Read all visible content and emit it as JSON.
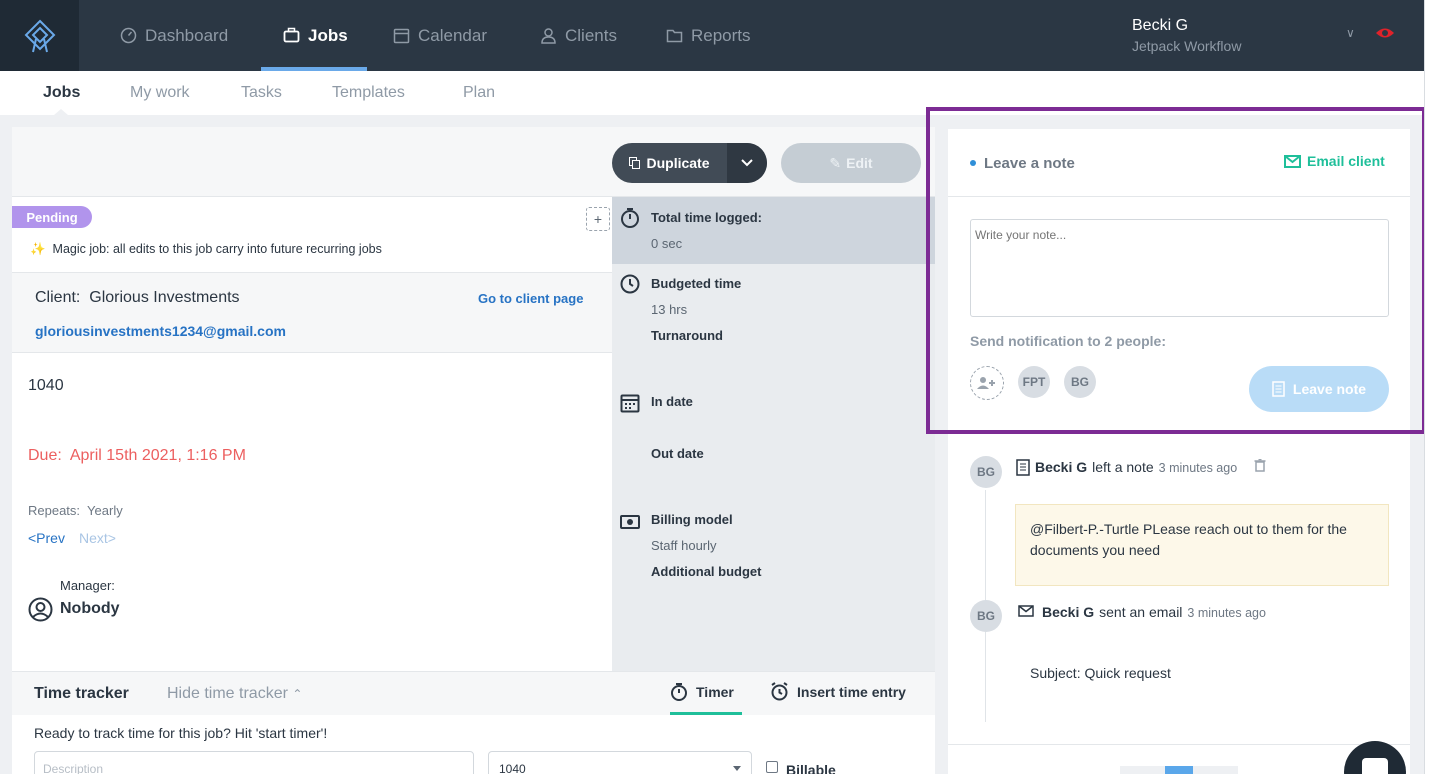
{
  "nav": {
    "items": [
      {
        "label": "Dashboard",
        "icon": "gauge-icon"
      },
      {
        "label": "Jobs",
        "icon": "briefcase-icon"
      },
      {
        "label": "Calendar",
        "icon": "calendar-icon"
      },
      {
        "label": "Clients",
        "icon": "user-icon"
      },
      {
        "label": "Reports",
        "icon": "folder-icon"
      }
    ],
    "active": "Jobs",
    "user_name": "Becki G",
    "user_org": "Jetpack Workflow"
  },
  "subtabs": [
    "Jobs",
    "My work",
    "Tasks",
    "Templates",
    "Plan"
  ],
  "job": {
    "duplicate_label": "Duplicate",
    "edit_label": "Edit",
    "status_badge": "Pending",
    "magic_note": "Magic job: all edits to this job carry into future recurring jobs",
    "client_label": "Client:",
    "client_name": "Glorious Investments",
    "client_link": "Go to client page",
    "client_email": "gloriousinvestments1234@gmail.com",
    "name": "1040",
    "due_label": "Due:",
    "due_value": "April 15th 2021, 1:16 PM",
    "repeats_label": "Repeats:",
    "repeats_value": "Yearly",
    "prev_label": "<Prev",
    "next_label": "Next>",
    "manager_label": "Manager:",
    "manager_value": "Nobody"
  },
  "details": {
    "total_time_label": "Total time logged:",
    "total_time_value": "0 sec",
    "budgeted_label": "Budgeted time",
    "budgeted_value": "13 hrs",
    "turnaround_label": "Turnaround",
    "in_date_label": "In date",
    "out_date_label": "Out date",
    "billing_label": "Billing model",
    "billing_value": "Staff hourly",
    "additional_label": "Additional budget"
  },
  "time_tracker": {
    "title": "Time tracker",
    "hide_label": "Hide time tracker",
    "timer_label": "Timer",
    "insert_label": "Insert time entry",
    "ready_text": "Ready to track time for this job? Hit 'start timer'!",
    "description_placeholder": "Description",
    "job_select_value": "1040",
    "billable_label": "Billable"
  },
  "notes": {
    "title": "Leave a note",
    "email_client_label": "Email client",
    "note_placeholder": "Write your note...",
    "notify_label": "Send notification to 2 people:",
    "recipients": [
      "FPT",
      "BG"
    ],
    "leave_note_label": "Leave note",
    "activities": [
      {
        "avatar": "BG",
        "who": "Becki G",
        "action": "left a note",
        "time": "3 minutes ago"
      },
      {
        "avatar": "BG",
        "who": "Becki G",
        "action": "sent an email",
        "time": "3 minutes ago"
      }
    ],
    "note_body": "@Filbert-P.-Turtle PLease reach out to them for the documents you need",
    "email_subject": "Subject: Quick request"
  },
  "colors": {
    "nav_bg": "#2b3744",
    "accent_green": "#1fbf9a",
    "link_blue": "#2773c4",
    "due_red": "#ec5f5f",
    "pending_purple": "#b194ec",
    "highlight_frame": "#7c2b94"
  }
}
